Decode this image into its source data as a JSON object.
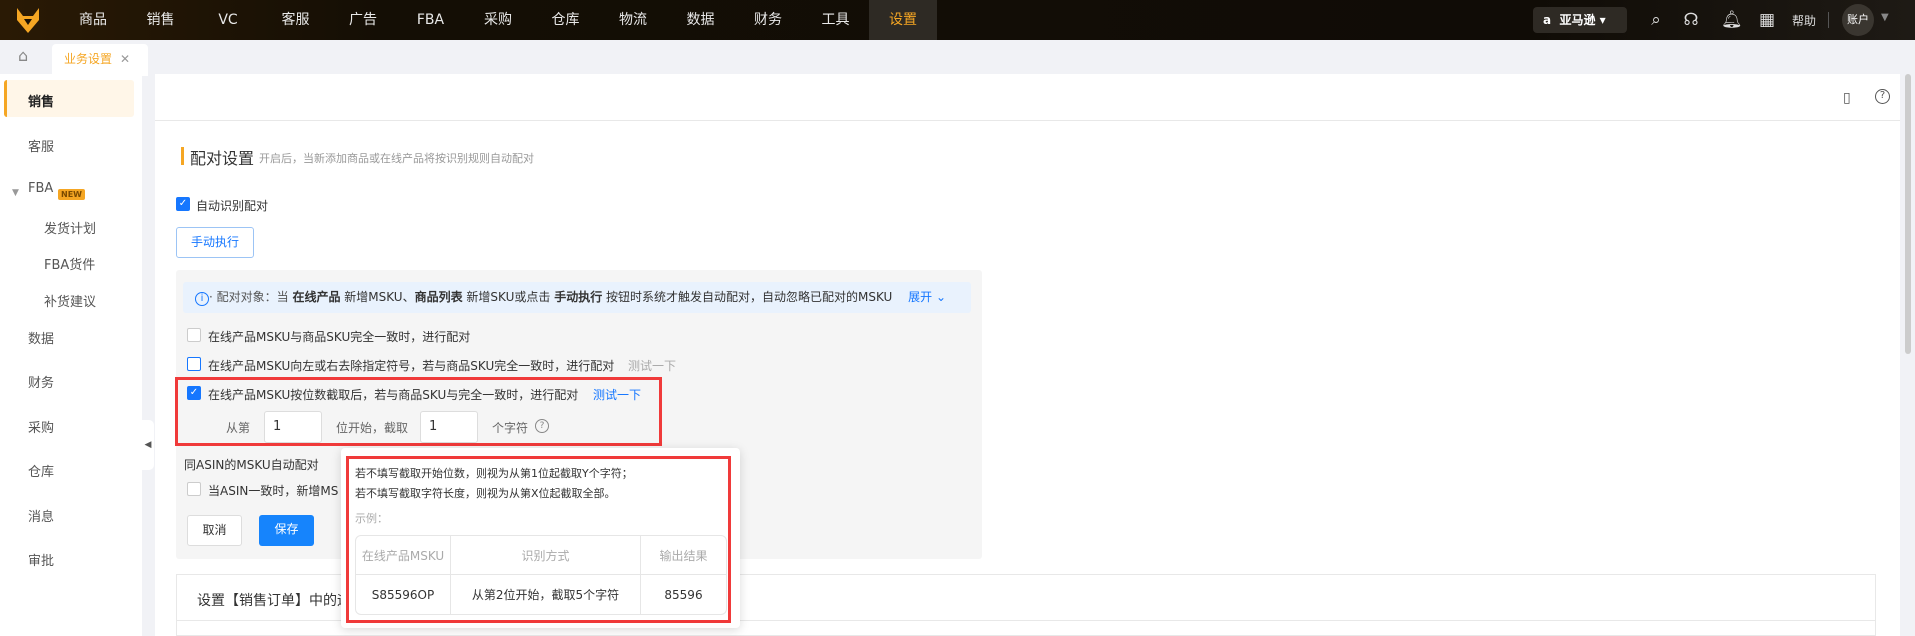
{
  "topnav": {
    "items": [
      "商品",
      "销售",
      "VC",
      "客服",
      "广告",
      "FBA",
      "采购",
      "仓库",
      "物流",
      "数据",
      "财务",
      "工具",
      "设置"
    ],
    "active": "设置",
    "marketplace": "亚马逊",
    "help": "帮助",
    "account": "账户"
  },
  "tabs": {
    "current": "业务设置"
  },
  "sidebar": {
    "items": [
      {
        "label": "销售"
      },
      {
        "label": "客服"
      },
      {
        "label": "FBA"
      },
      {
        "label": "发货计划"
      },
      {
        "label": "FBA货件"
      },
      {
        "label": "补货建议"
      },
      {
        "label": "数据"
      },
      {
        "label": "财务"
      },
      {
        "label": "采购"
      },
      {
        "label": "仓库"
      },
      {
        "label": "消息"
      },
      {
        "label": "审批"
      }
    ],
    "new_badge": "NEW"
  },
  "section": {
    "title": "配对设置",
    "subtitle": "开启后，当新添加商品或在线产品将按识别规则自动配对",
    "auto_match": "自动识别配对",
    "manual_run": "手动执行",
    "info": {
      "prefix": "· 配对对象：当 ",
      "b1": "在线产品",
      "t1": " 新增MSKU、",
      "b2": "商品列表",
      "t2": " 新增SKU或点击 ",
      "b3": "手动执行",
      "t3": " 按钮时系统才触发自动配对，自动忽略已配对的MSKU",
      "expand": "展开"
    },
    "rule1": "在线产品MSKU与商品SKU完全一致时，进行配对",
    "rule2": "在线产品MSKU向左或右去除指定符号，若与商品SKU完全一致时，进行配对",
    "rule2_test": "测试一下",
    "rule3": "在线产品MSKU按位数截取后，若与商品SKU与完全一致时，进行配对",
    "rule3_test": "测试一下",
    "from_label": "从第",
    "start_value": "1",
    "mid_label": "位开始，截取",
    "length_value": "1",
    "chars_label": "个字符",
    "asin_title": "同ASIN的MSKU自动配对",
    "asin_rule": "当ASIN一致时，新增MS",
    "cancel": "取消",
    "save": "保存"
  },
  "card2": {
    "title": "设置【销售订单】中的运"
  },
  "tooltip": {
    "line1": "若不填写截取开始位数，则视为从第1位起截取Y个字符；",
    "line2": "若不填写截取字符长度，则视为从第X位起截取全部。",
    "example_label": "示例：",
    "headers": [
      "在线产品MSKU",
      "识别方式",
      "输出结果"
    ],
    "row": [
      "S85596OP",
      "从第2位开始，截取5个字符",
      "85596"
    ]
  }
}
